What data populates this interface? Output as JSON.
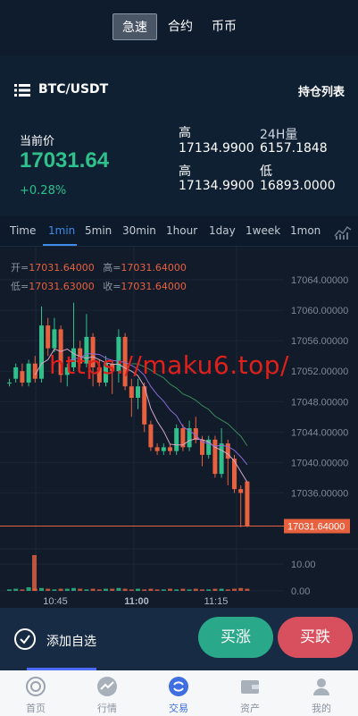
{
  "topbar": {
    "tabs": [
      {
        "label": "急速",
        "active": true
      },
      {
        "label": "合约"
      },
      {
        "label": "币币"
      }
    ]
  },
  "header": {
    "pair": "BTC/USDT",
    "positions_link": "持仓列表",
    "current_price_label": "当前价",
    "current_price": "17031.64",
    "change": "+0.28%",
    "stats": {
      "high_label": "高",
      "high_value": "17134.9900",
      "vol_label": "24H量",
      "vol_value": "6157.1848",
      "high2_label": "高",
      "high2_value": "17134.9900",
      "low_label": "低",
      "low_value": "16893.0000"
    }
  },
  "intervals": [
    "Time",
    "1min",
    "5min",
    "30min",
    "1hour",
    "1day",
    "1week",
    "1mon"
  ],
  "active_interval": "1min",
  "ohlc": {
    "open_label": "开=",
    "open": "17031.64000",
    "high_label": "高=",
    "high": "17031.64000",
    "low_label": "低=",
    "low": "17031.63000",
    "close_label": "收=",
    "close": "17031.64000"
  },
  "watermark": "https://maku6.top/",
  "colors": {
    "up": "#2fc08c",
    "down": "#e8613f",
    "accent": "#3f8ce8",
    "buy": "#2aa88a",
    "sell": "#d8505e"
  },
  "chart_data": {
    "type": "candlestick",
    "y_ticks": [
      "17064.00000",
      "17060.00000",
      "17056.00000",
      "17052.00000",
      "17048.00000",
      "17044.00000",
      "17040.00000",
      "17036.00000"
    ],
    "current_price_tag": "17031.64000",
    "volume_ticks": [
      "10.00",
      "0.00"
    ],
    "x_ticks": [
      "10:45",
      "11:00",
      "11:15"
    ],
    "ylim": [
      17031,
      17066
    ],
    "candles": [
      {
        "o": 17050.5,
        "c": 17050.5,
        "h": 17051.0,
        "l": 17050.0
      },
      {
        "o": 17051.0,
        "c": 17052.5,
        "h": 17053.0,
        "l": 17050.5
      },
      {
        "o": 17052.0,
        "c": 17050.5,
        "h": 17053.0,
        "l": 17050.0
      },
      {
        "o": 17050.5,
        "c": 17053.0,
        "h": 17053.5,
        "l": 17050.0
      },
      {
        "o": 17053.0,
        "c": 17051.0,
        "h": 17054.0,
        "l": 17050.5
      },
      {
        "o": 17051.0,
        "c": 17058.0,
        "h": 17060.5,
        "l": 17050.5
      },
      {
        "o": 17058.0,
        "c": 17055.0,
        "h": 17059.0,
        "l": 17054.0
      },
      {
        "o": 17055.0,
        "c": 17057.5,
        "h": 17059.0,
        "l": 17054.5
      },
      {
        "o": 17057.5,
        "c": 17051.5,
        "h": 17058.0,
        "l": 17050.5
      },
      {
        "o": 17051.5,
        "c": 17052.5,
        "h": 17053.0,
        "l": 17050.0
      },
      {
        "o": 17052.5,
        "c": 17055.0,
        "h": 17061.0,
        "l": 17052.0
      },
      {
        "o": 17055.0,
        "c": 17053.0,
        "h": 17056.0,
        "l": 17052.5
      },
      {
        "o": 17053.0,
        "c": 17056.5,
        "h": 17059.5,
        "l": 17052.5
      },
      {
        "o": 17056.5,
        "c": 17052.5,
        "h": 17057.0,
        "l": 17050.0
      },
      {
        "o": 17052.5,
        "c": 17050.5,
        "h": 17053.5,
        "l": 17050.0
      },
      {
        "o": 17050.5,
        "c": 17053.0,
        "h": 17054.0,
        "l": 17050.0
      },
      {
        "o": 17053.0,
        "c": 17052.0,
        "h": 17053.5,
        "l": 17049.0
      },
      {
        "o": 17052.0,
        "c": 17056.5,
        "h": 17057.5,
        "l": 17050.5
      },
      {
        "o": 17056.5,
        "c": 17050.0,
        "h": 17057.0,
        "l": 17049.5
      },
      {
        "o": 17050.0,
        "c": 17048.5,
        "h": 17051.0,
        "l": 17046.0
      },
      {
        "o": 17048.5,
        "c": 17050.0,
        "h": 17051.0,
        "l": 17047.0
      },
      {
        "o": 17050.0,
        "c": 17045.0,
        "h": 17050.5,
        "l": 17044.0
      },
      {
        "o": 17045.0,
        "c": 17042.0,
        "h": 17045.5,
        "l": 17041.5
      },
      {
        "o": 17042.0,
        "c": 17041.5,
        "h": 17042.5,
        "l": 17041.0
      },
      {
        "o": 17041.5,
        "c": 17042.0,
        "h": 17042.5,
        "l": 17041.0
      },
      {
        "o": 17042.0,
        "c": 17041.5,
        "h": 17042.5,
        "l": 17041.0
      },
      {
        "o": 17041.5,
        "c": 17044.5,
        "h": 17045.0,
        "l": 17041.0
      },
      {
        "o": 17044.5,
        "c": 17042.0,
        "h": 17045.0,
        "l": 17041.5
      },
      {
        "o": 17042.0,
        "c": 17044.5,
        "h": 17045.5,
        "l": 17041.5
      },
      {
        "o": 17044.5,
        "c": 17043.0,
        "h": 17046.0,
        "l": 17042.5
      },
      {
        "o": 17043.0,
        "c": 17041.0,
        "h": 17043.5,
        "l": 17039.5
      },
      {
        "o": 17041.0,
        "c": 17043.0,
        "h": 17043.5,
        "l": 17040.5
      },
      {
        "o": 17043.0,
        "c": 17038.5,
        "h": 17043.5,
        "l": 17038.0
      },
      {
        "o": 17038.5,
        "c": 17042.5,
        "h": 17044.5,
        "l": 17038.0
      },
      {
        "o": 17042.5,
        "c": 17040.5,
        "h": 17043.0,
        "l": 17037.0
      },
      {
        "o": 17040.5,
        "c": 17036.5,
        "h": 17041.0,
        "l": 17036.0
      },
      {
        "o": 17036.5,
        "c": 17036.0,
        "h": 17037.0,
        "l": 17031.5
      },
      {
        "o": 17037.5,
        "c": 17031.6,
        "h": 17037.5,
        "l": 17031.5
      }
    ],
    "volumes": [
      0.2,
      0.3,
      0.2,
      0.5,
      0.3,
      0.4,
      0.3,
      0.2,
      0.3,
      0.3,
      0.4,
      0.3,
      0.2,
      0.3,
      0.2,
      0.3,
      0.3,
      0.4,
      0.3,
      0.2,
      0.3,
      0.2,
      0.3,
      0.2,
      0.2,
      0.3,
      0.2,
      0.3,
      0.2,
      0.3,
      0.2,
      0.2,
      0.3,
      0.3,
      0.2,
      0.3,
      0.4,
      0.3
    ]
  },
  "bottom": {
    "fav_label": "添加自选",
    "buy_label": "买涨",
    "sell_label": "买跌"
  },
  "nav": [
    {
      "label": "首页",
      "icon": "home-icon"
    },
    {
      "label": "行情",
      "icon": "market-icon"
    },
    {
      "label": "交易",
      "icon": "trade-icon",
      "active": true
    },
    {
      "label": "资产",
      "icon": "wallet-icon"
    },
    {
      "label": "我的",
      "icon": "user-icon"
    }
  ]
}
